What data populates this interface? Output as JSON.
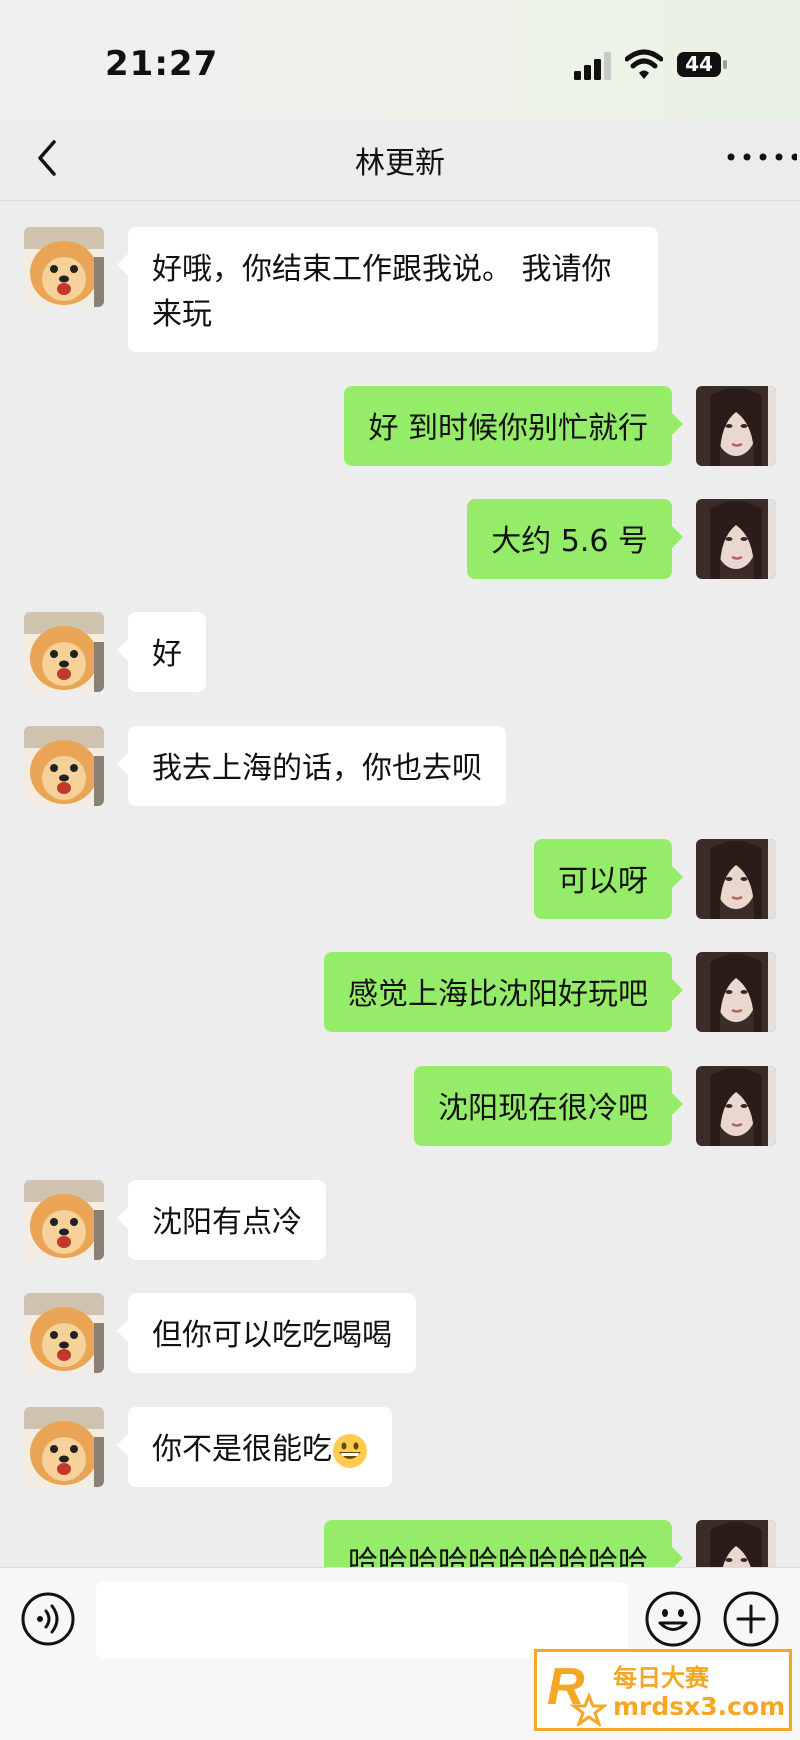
{
  "status_bar": {
    "time": "21:27",
    "battery": "44"
  },
  "header": {
    "title": "林更新"
  },
  "messages": [
    {
      "side": "left",
      "text": "好哦，你结束工作跟我说。 我请你来玩"
    },
    {
      "side": "right",
      "text": "好 到时候你别忙就行"
    },
    {
      "side": "right",
      "text": "大约 5.6 号"
    },
    {
      "side": "left",
      "text": "好"
    },
    {
      "side": "left",
      "text": "我去上海的话，你也去呗"
    },
    {
      "side": "right",
      "text": "可以呀"
    },
    {
      "side": "right",
      "text": "感觉上海比沈阳好玩吧"
    },
    {
      "side": "right",
      "text": "沈阳现在很冷吧"
    },
    {
      "side": "left",
      "text": "沈阳有点冷"
    },
    {
      "side": "left",
      "text": "但你可以吃吃喝喝"
    },
    {
      "side": "left",
      "text": "你不是很能吃",
      "emoji": "grinning-face-emoji"
    },
    {
      "side": "right",
      "text": "哈哈哈哈哈哈哈哈哈哈"
    }
  ],
  "input_bar": {
    "placeholder": ""
  },
  "watermark": {
    "brand": "每日大赛",
    "site": "mrdsx3.com",
    "logo_letter": "R"
  },
  "colors": {
    "self_bubble": "#95ec69",
    "other_bubble": "#ffffff",
    "background": "#ededed"
  },
  "icons": [
    "back-chevron-icon",
    "more-dots-icon",
    "voice-icon",
    "emoji-icon",
    "plus-icon",
    "signal-icon",
    "wifi-icon",
    "battery-icon"
  ]
}
